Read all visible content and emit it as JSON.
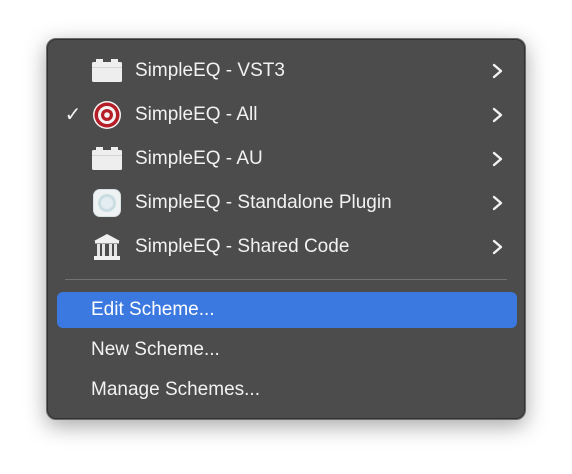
{
  "menu": {
    "targets": [
      {
        "label": "SimpleEQ - VST3",
        "icon": "plugin-icon",
        "checked": false,
        "has_submenu": true
      },
      {
        "label": "SimpleEQ - All",
        "icon": "target-icon",
        "checked": true,
        "has_submenu": true
      },
      {
        "label": "SimpleEQ - AU",
        "icon": "plugin-icon",
        "checked": false,
        "has_submenu": true
      },
      {
        "label": "SimpleEQ - Standalone Plugin",
        "icon": "app-icon",
        "checked": false,
        "has_submenu": true
      },
      {
        "label": "SimpleEQ - Shared Code",
        "icon": "library-icon",
        "checked": false,
        "has_submenu": true
      }
    ],
    "check_mark": "✓",
    "actions": [
      {
        "label": "Edit Scheme...",
        "selected": true
      },
      {
        "label": "New Scheme...",
        "selected": false
      },
      {
        "label": "Manage Schemes...",
        "selected": false
      }
    ]
  },
  "colors": {
    "menu_background": "#4c4c4d",
    "highlight": "#3b79e0",
    "text": "#f2f2f2",
    "target_icon_red": "#c0202a"
  }
}
